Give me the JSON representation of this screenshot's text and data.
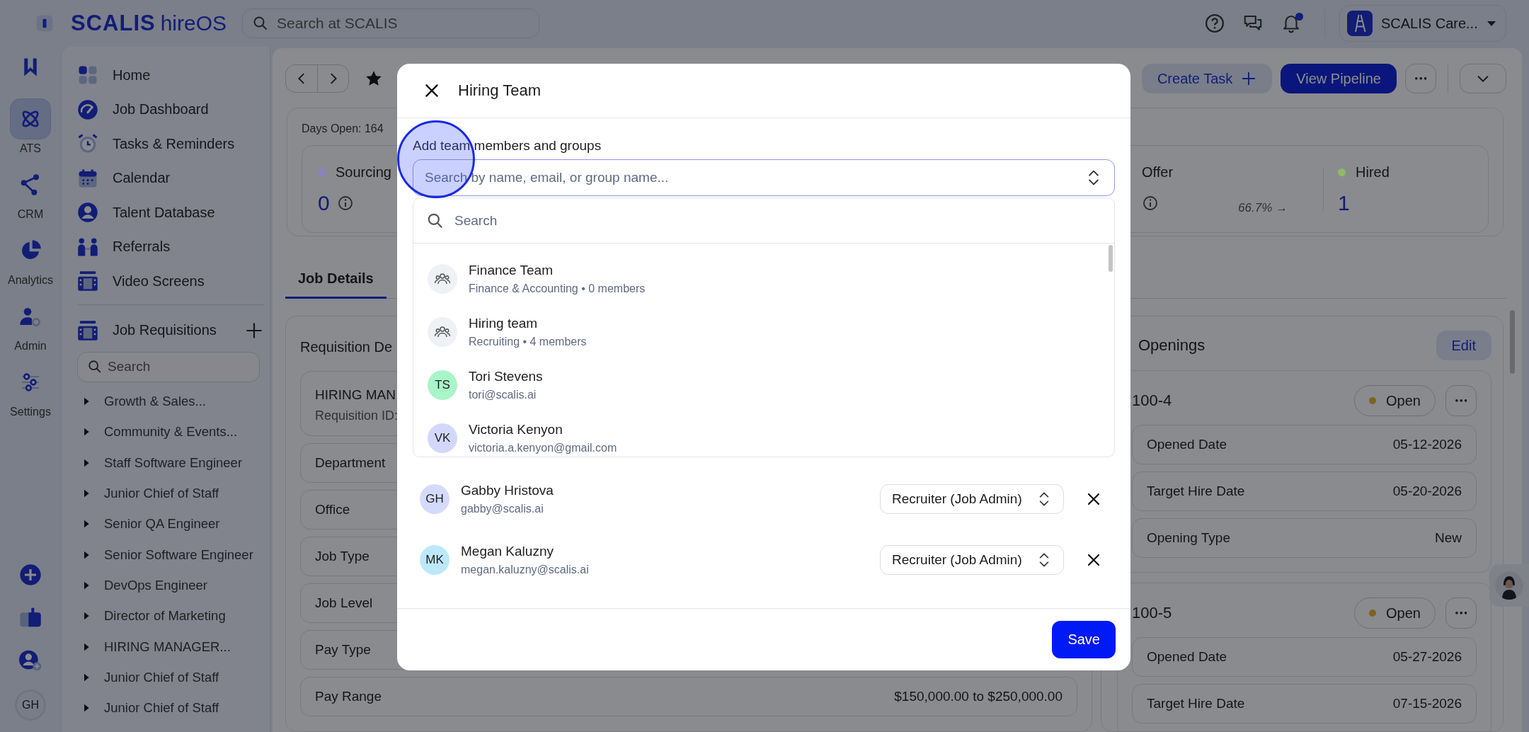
{
  "topbar": {
    "logo": "SCALIS",
    "logo_suffix": "hireOS",
    "search": {
      "placeholder": "Search at SCALIS"
    },
    "notifications_unread": true,
    "account": {
      "name": "SCALIS Care..."
    }
  },
  "rail": {
    "items": [
      {
        "label": "ATS",
        "selected": true
      },
      {
        "label": "CRM",
        "selected": false
      },
      {
        "label": "Analytics",
        "selected": false
      },
      {
        "label": "Admin",
        "selected": false
      },
      {
        "label": "Settings",
        "selected": false
      }
    ],
    "user_initials": "GH"
  },
  "sidebar": {
    "nav": [
      {
        "label": "Home"
      },
      {
        "label": "Job Dashboard"
      },
      {
        "label": "Tasks & Reminders"
      },
      {
        "label": "Calendar"
      },
      {
        "label": "Talent Database"
      },
      {
        "label": "Referrals"
      },
      {
        "label": "Video Screens"
      }
    ],
    "requisitions": {
      "title": "Job Requisitions",
      "search": {
        "placeholder": "Search"
      },
      "items": [
        {
          "label": "Growth & Sales...",
          "expanded": false
        },
        {
          "label": "Community & Events...",
          "expanded": false
        },
        {
          "label": "Staff Software Engineer",
          "expanded": false
        },
        {
          "label": "Junior Chief of Staff",
          "expanded": false
        },
        {
          "label": "Senior QA Engineer",
          "expanded": false
        },
        {
          "label": "Senior Software Engineer",
          "expanded": false
        },
        {
          "label": "DevOps Engineer",
          "expanded": false
        },
        {
          "label": "Director of Marketing",
          "expanded": false
        },
        {
          "label": "HIRING MANAGER...",
          "expanded": false
        },
        {
          "label": "Junior Chief of Staff",
          "expanded": false
        },
        {
          "label": "Junior Chief of Staff",
          "expanded": false
        }
      ]
    }
  },
  "job": {
    "starred": true,
    "actions": {
      "create_task": "Create Task",
      "view_pipeline": "View Pipeline"
    },
    "days_open": "Days Open: 164",
    "stages": [
      {
        "name": "Sourcing",
        "count": "0",
        "color": "#8b82c4"
      },
      {
        "name": "Offer",
        "conversion": "66.7% →"
      },
      {
        "name": "Hired",
        "count": "1",
        "color": "#8fba62"
      }
    ]
  },
  "tabs": [
    {
      "label": "Job Details",
      "selected": true
    }
  ],
  "requisition_details": {
    "title": "Requisition De",
    "header": {
      "title": "HIRING MAN",
      "subtitle": "Requisition ID:"
    },
    "fields": [
      {
        "label": "Department"
      },
      {
        "label": "Office"
      },
      {
        "label": "Job Type"
      },
      {
        "label": "Job Level"
      },
      {
        "label": "Pay Type"
      },
      {
        "label": "Pay Range",
        "value": "$150,000.00 to $250,000.00"
      }
    ]
  },
  "openings": {
    "title": "Openings",
    "edit": "Edit",
    "items": [
      {
        "id": "100-4",
        "status": "Open",
        "fields": [
          {
            "label": "Opened Date",
            "value": "05-12-2026"
          },
          {
            "label": "Target Hire Date",
            "value": "05-20-2026"
          },
          {
            "label": "Opening Type",
            "value": "New"
          }
        ]
      },
      {
        "id": "100-5",
        "status": "Open",
        "fields": [
          {
            "label": "Opened Date",
            "value": "05-27-2026"
          },
          {
            "label": "Target Hire Date",
            "value": "07-15-2026"
          }
        ]
      }
    ]
  },
  "modal": {
    "title": "Hiring Team",
    "field_label": "Add team members and groups",
    "select": {
      "placeholder": "Search by name, email, or group name..."
    },
    "dropdown": {
      "search": {
        "placeholder": "Search"
      },
      "options": [
        {
          "kind": "group",
          "name": "Finance Team",
          "detail": "Finance & Accounting • 0 members"
        },
        {
          "kind": "group",
          "name": "Hiring team",
          "detail": "Recruiting • 4 members"
        },
        {
          "kind": "person",
          "initials": "TS",
          "name": "Tori Stevens",
          "detail": "tori@scalis.ai",
          "color": "#a9f5c9"
        },
        {
          "kind": "person",
          "initials": "VK",
          "name": "Victoria Kenyon",
          "detail": "victoria.a.kenyon@gmail.com",
          "color": "#d3d8fb"
        }
      ]
    },
    "members": [
      {
        "initials": "GH",
        "name": "Gabby Hristova",
        "email": "gabby@scalis.ai",
        "role": "Recruiter (Job Admin)",
        "color": "#d4dafc"
      },
      {
        "initials": "MK",
        "name": "Megan Kaluzny",
        "email": "megan.kaluzny@scalis.ai",
        "role": "Recruiter (Job Admin)",
        "color": "#bde8fb"
      }
    ],
    "save": "Save"
  }
}
